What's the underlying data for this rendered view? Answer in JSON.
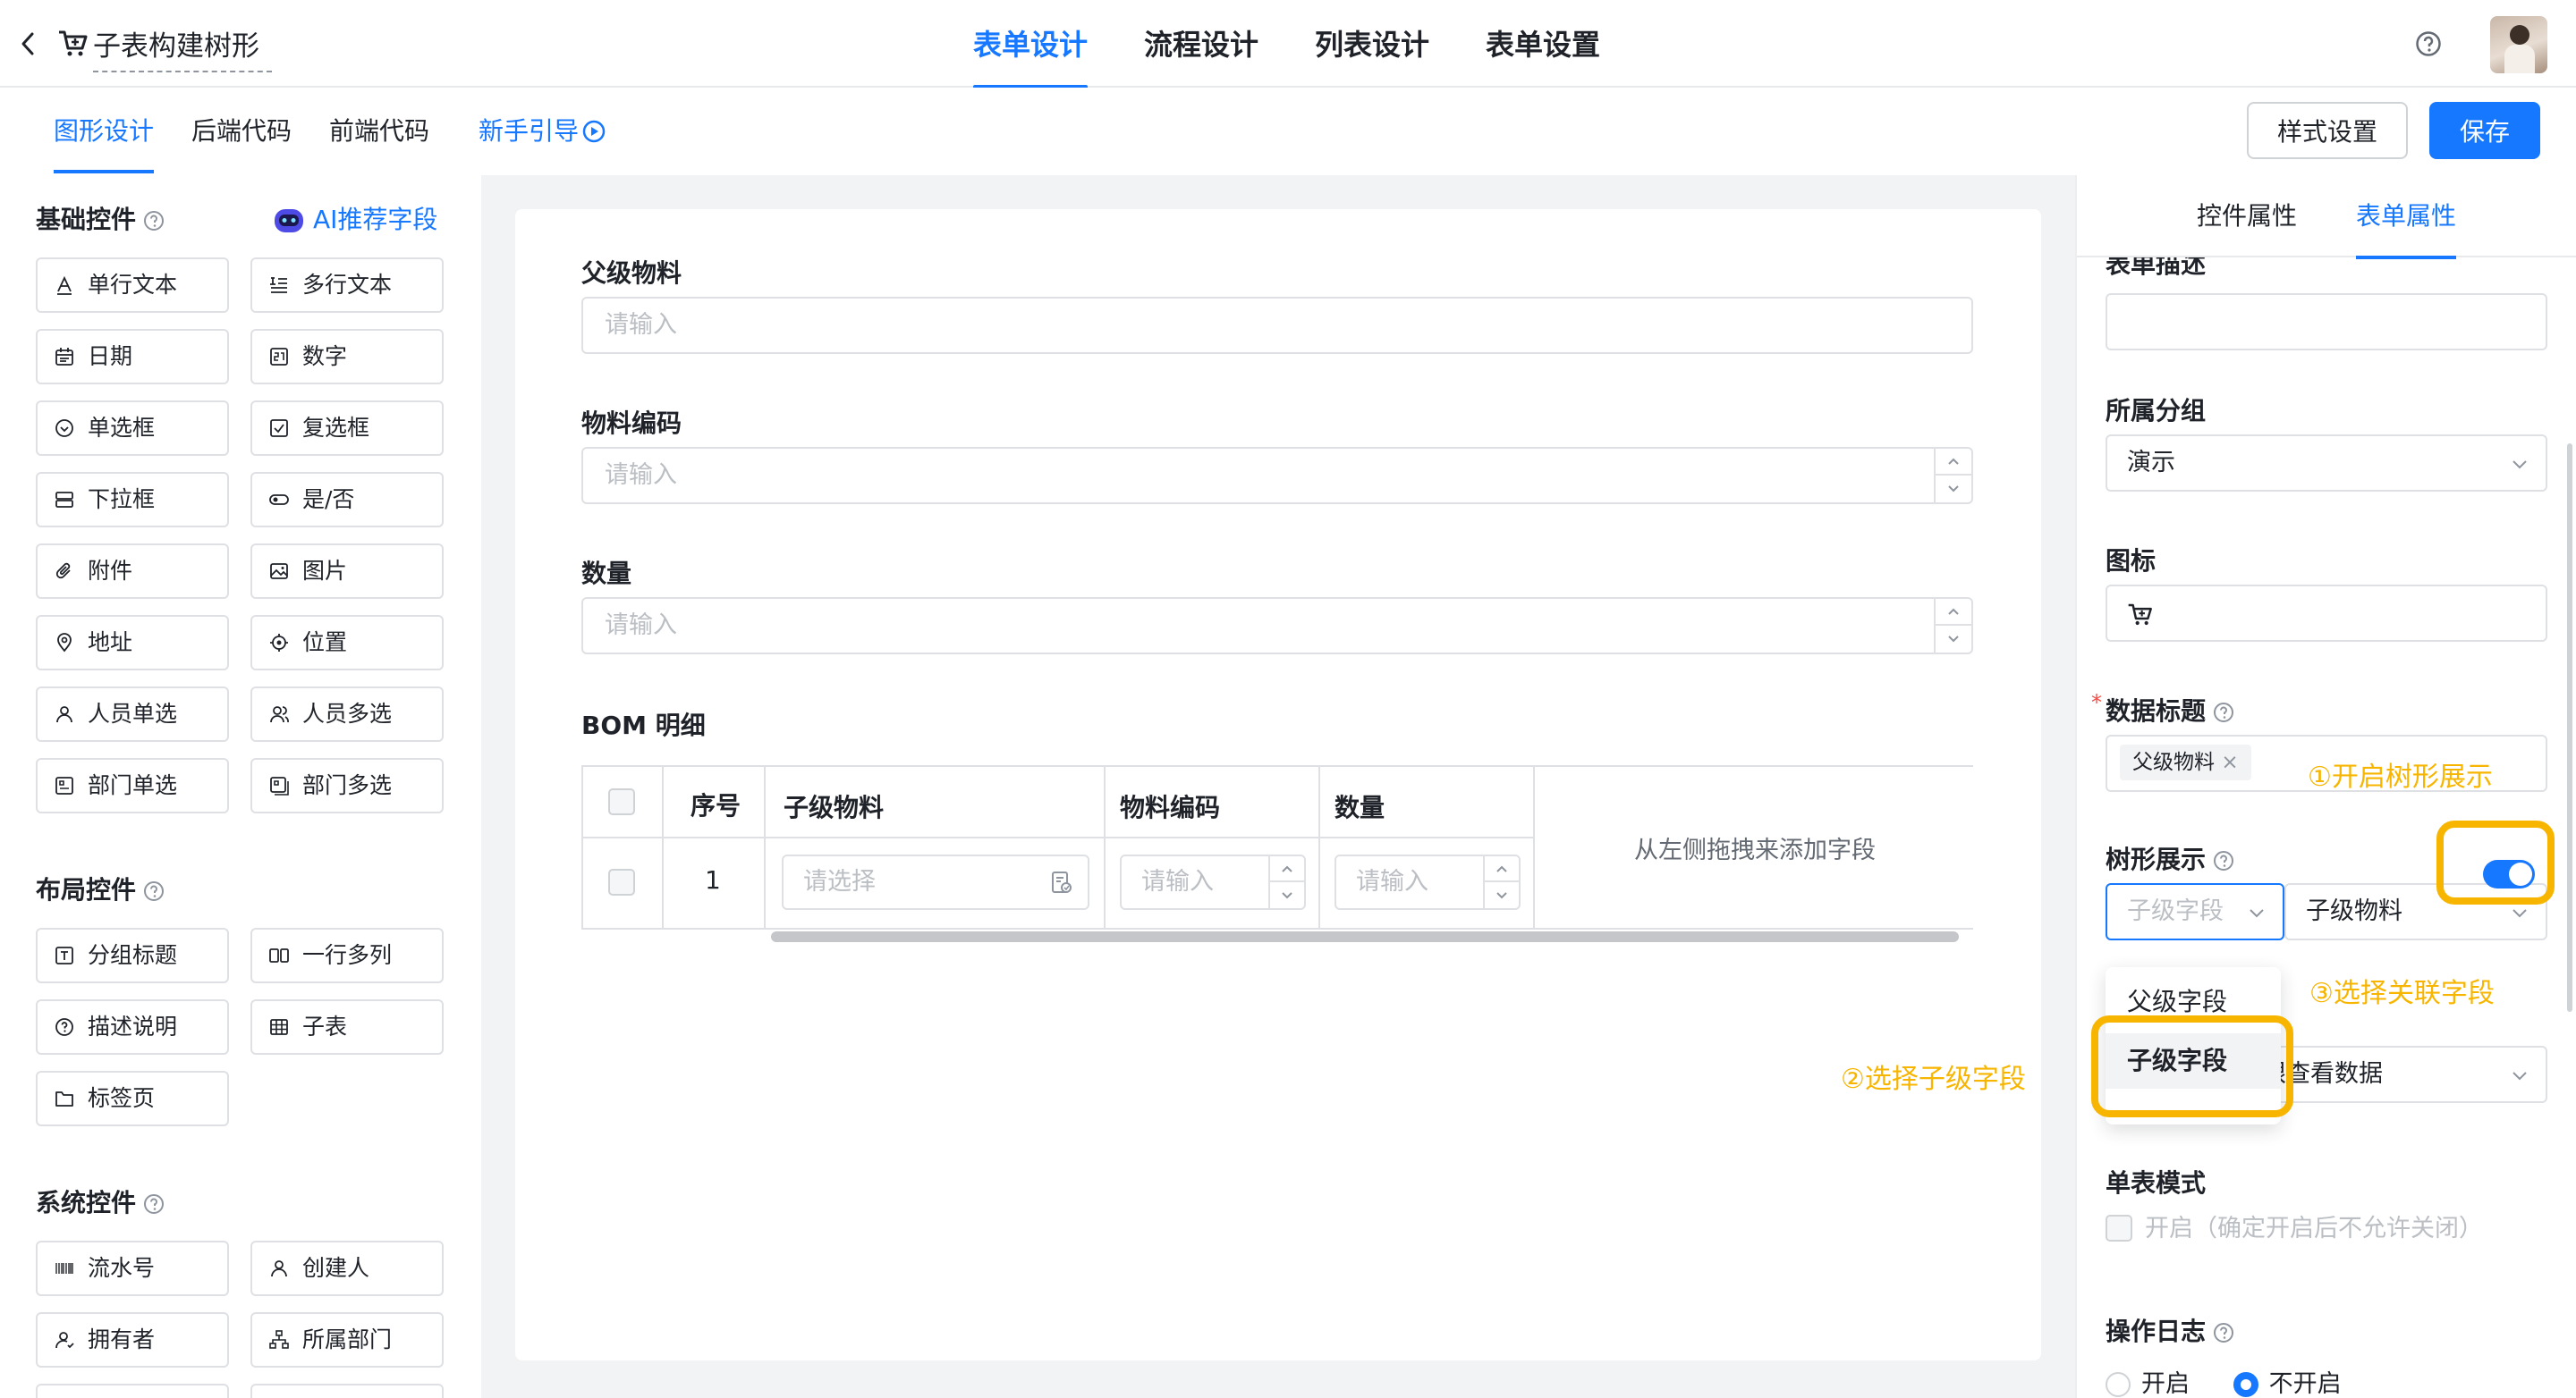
{
  "header": {
    "title": "子表构建树形",
    "tabs": [
      "表单设计",
      "流程设计",
      "列表设计",
      "表单设置"
    ],
    "active_tab": "表单设计"
  },
  "subbar": {
    "tabs": [
      "图形设计",
      "后端代码",
      "前端代码"
    ],
    "guide": "新手引导",
    "style_button": "样式设置",
    "save_button": "保存"
  },
  "left_panel": {
    "basic_title": "基础控件",
    "ai_link": "AI推荐字段",
    "basic_controls": [
      "单行文本",
      "多行文本",
      "日期",
      "数字",
      "单选框",
      "复选框",
      "下拉框",
      "是/否",
      "附件",
      "图片",
      "地址",
      "位置",
      "人员单选",
      "人员多选",
      "部门单选",
      "部门多选"
    ],
    "layout_title": "布局控件",
    "layout_controls": [
      "分组标题",
      "一行多列",
      "描述说明",
      "子表",
      "标签页"
    ],
    "system_title": "系统控件",
    "system_controls": [
      "流水号",
      "创建人",
      "拥有者",
      "所属部门"
    ]
  },
  "form": {
    "fields": [
      {
        "label": "父级物料",
        "placeholder": "请输入"
      },
      {
        "label": "物料编码",
        "placeholder": "请输入"
      },
      {
        "label": "数量",
        "placeholder": "请输入"
      }
    ],
    "subtable": {
      "title": "BOM 明细",
      "headers": [
        "序号",
        "子级物料",
        "物料编码",
        "数量"
      ],
      "row_index": "1",
      "select_placeholder": "请选择",
      "input_placeholder": "请输入",
      "drop_hint": "从左侧拖拽来添加字段"
    }
  },
  "right_panel": {
    "tabs": [
      "控件属性",
      "表单属性"
    ],
    "active_tab": "表单属性",
    "desc_label": "表单描述",
    "group_label": "所属分组",
    "group_value": "演示",
    "icon_label": "图标",
    "data_title_label": "数据标题",
    "data_title_tag": "父级物料",
    "tree_label": "树形展示",
    "tree_enabled": true,
    "tree_child_field_placeholder": "子级字段",
    "tree_parent_field": "子级物料",
    "dropdown_options": [
      "父级字段",
      "子级字段"
    ],
    "permission_value": "权限查看数据",
    "single_mode_label": "单表模式",
    "single_mode_option": "开启（确定开启后不允许关闭）",
    "log_label": "操作日志",
    "log_options": [
      "开启",
      "不开启"
    ]
  },
  "annotations": {
    "step1": "①开启树形展示",
    "step2": "②选择子级字段",
    "step3": "③选择关联字段",
    "color": "#f7b500"
  },
  "colors": {
    "accent": "#1677ff",
    "highlight": "#f7b500"
  }
}
